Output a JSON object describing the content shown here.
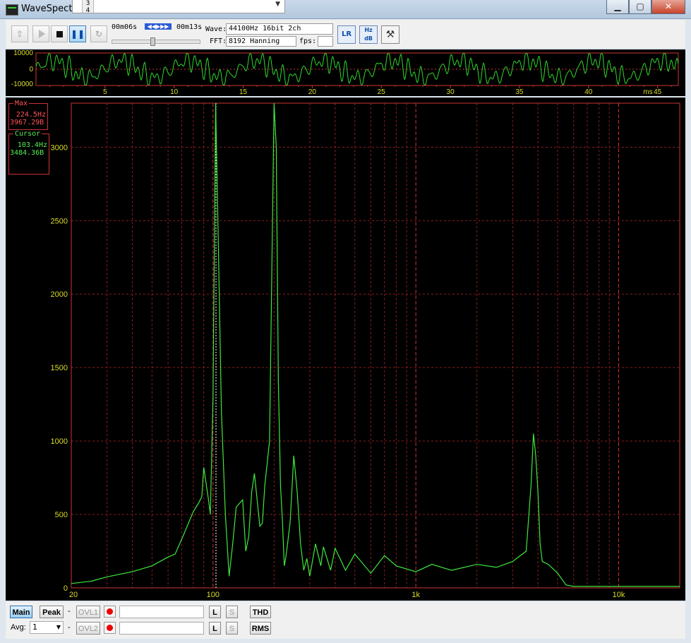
{
  "window": {
    "title": "WaveSpectra",
    "dropdown_items": [
      "3",
      "4"
    ],
    "controls": {
      "minimize": "▁",
      "maximize": "▢",
      "close": "✕"
    }
  },
  "toolbar": {
    "time_current": "00m06s",
    "time_total": "00m13s",
    "seek_icons": "◀◀▶▶▶",
    "wave_label": "Wave:",
    "wave_value": "44100Hz 16bit 2ch",
    "fft_label": "FFT:",
    "fft_value": "8192 Hanning",
    "fps_label": "fps:",
    "fps_value": "",
    "lr_button": "LR",
    "hz_db_button": "Hz dB",
    "settings_icon": "wrench-icon"
  },
  "waveform": {
    "y_ticks": [
      "10000",
      "0",
      "-10000"
    ],
    "x_ticks": [
      "5",
      "10",
      "15",
      "20",
      "25",
      "30",
      "35",
      "40",
      "45"
    ],
    "x_unit": "ms"
  },
  "spectrum": {
    "max_label": "Max",
    "max_freq": "224.5Hz",
    "max_value": "3967.29B",
    "cursor_label": "Cursor",
    "cursor_freq": "103.4Hz",
    "cursor_value": "3484.36B",
    "x_ticks": [
      "20",
      "100",
      "1k",
      "10k"
    ],
    "y_ticks": [
      "3000",
      "2500",
      "2000",
      "1500",
      "1000",
      "500",
      "0"
    ]
  },
  "chart_data": {
    "type": "line",
    "x_scale": "log",
    "xlim": [
      20,
      20000
    ],
    "ylim": [
      0,
      3300
    ],
    "grid": true,
    "x": [
      20,
      25,
      30,
      40,
      50,
      60,
      65,
      70,
      80,
      85,
      88,
      90,
      95,
      97,
      100,
      103,
      106,
      110,
      115,
      120,
      125,
      130,
      140,
      145,
      150,
      155,
      160,
      170,
      175,
      180,
      190,
      200,
      205,
      210,
      215,
      220,
      224.5,
      228,
      232,
      240,
      250,
      260,
      270,
      280,
      290,
      300,
      320,
      340,
      350,
      380,
      400,
      450,
      500,
      600,
      700,
      800,
      1000,
      1200,
      1500,
      2000,
      2500,
      3000,
      3500,
      3700,
      3800,
      3900,
      4000,
      4100,
      4200,
      4500,
      5000,
      5500,
      6000,
      8000,
      10000,
      15000,
      20000
    ],
    "series": [
      {
        "values": [
          30,
          45,
          75,
          110,
          150,
          210,
          230,
          330,
          520,
          580,
          620,
          820,
          600,
          500,
          1300,
          3300,
          2400,
          1200,
          500,
          80,
          300,
          550,
          600,
          250,
          350,
          650,
          780,
          420,
          440,
          700,
          1000,
          3300,
          3000,
          1400,
          700,
          450,
          150,
          200,
          280,
          450,
          900,
          650,
          300,
          120,
          200,
          80,
          300,
          150,
          280,
          120,
          270,
          120,
          230,
          100,
          220,
          150,
          110,
          160,
          120,
          160,
          140,
          180,
          250,
          700,
          1050,
          900,
          650,
          300,
          180,
          160,
          100,
          20,
          10,
          10,
          10,
          10,
          10
        ]
      }
    ]
  }
}
